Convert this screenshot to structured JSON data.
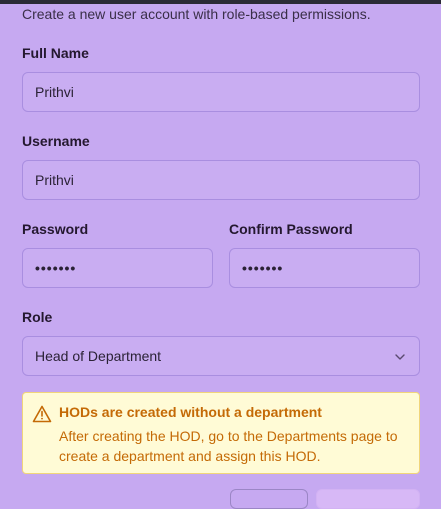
{
  "form": {
    "subtitle": "Create a new user account with role-based permissions.",
    "full_name": {
      "label": "Full Name",
      "value": "Prithvi"
    },
    "username": {
      "label": "Username",
      "value": "Prithvi"
    },
    "password": {
      "label": "Password",
      "value": "•••••••"
    },
    "confirm_password": {
      "label": "Confirm Password",
      "value": "•••••••"
    },
    "role": {
      "label": "Role",
      "selected": "Head of Department"
    }
  },
  "alert": {
    "title": "HODs are created without a department",
    "body": "After creating the HOD, go to the Departments page to create a department and assign this HOD.",
    "icon": "warning-triangle-icon",
    "color": "#c46a06"
  },
  "colors": {
    "background": "#c6a9f1",
    "field_border": "#a98ee0",
    "alert_bg": "#fffbd6"
  }
}
